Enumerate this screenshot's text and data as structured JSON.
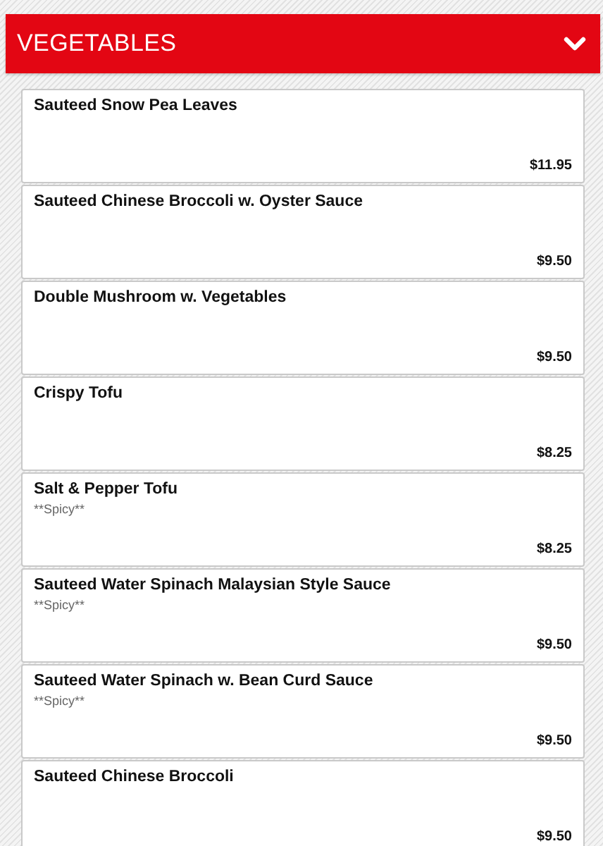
{
  "section": {
    "title": "VEGETABLES"
  },
  "items": [
    {
      "name": "Sauteed Snow Pea Leaves",
      "price": "$11.95"
    },
    {
      "name": "Sauteed Chinese Broccoli w. Oyster Sauce",
      "price": "$9.50"
    },
    {
      "name": "Double Mushroom w. Vegetables",
      "price": "$9.50"
    },
    {
      "name": "Crispy Tofu",
      "price": "$8.25"
    },
    {
      "name": "Salt & Pepper Tofu",
      "note": "**Spicy**",
      "price": "$8.25"
    },
    {
      "name": "Sauteed Water Spinach Malaysian Style Sauce",
      "note": "**Spicy**",
      "price": "$9.50"
    },
    {
      "name": "Sauteed Water Spinach w. Bean Curd Sauce",
      "note": "**Spicy**",
      "price": "$9.50"
    },
    {
      "name": "Sauteed Chinese Broccoli",
      "price": "$9.50"
    }
  ]
}
